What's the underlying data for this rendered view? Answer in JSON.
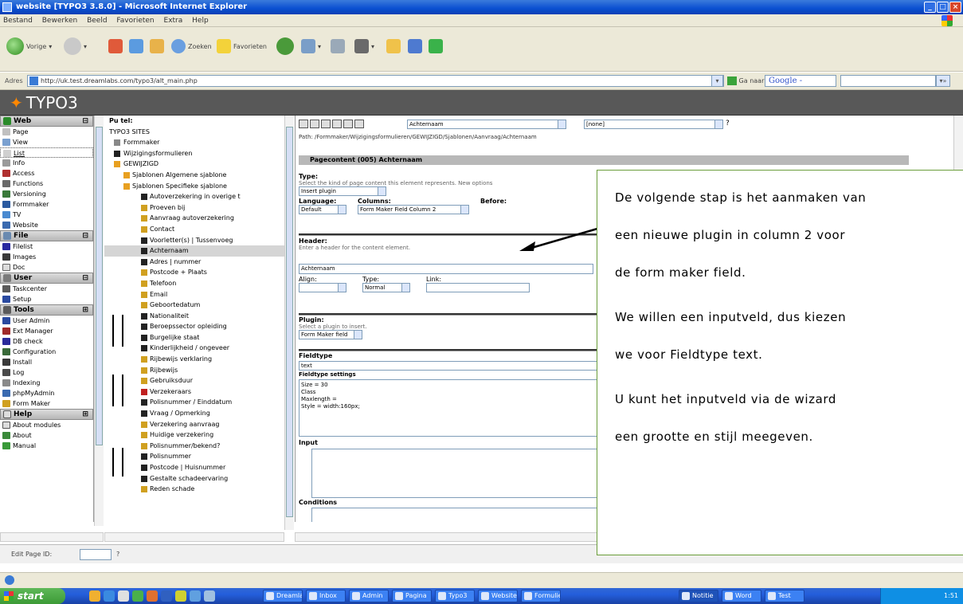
{
  "window": {
    "title": "website [TYPO3 3.8.0] - Microsoft Internet Explorer"
  },
  "menubar": [
    "Bestand",
    "Bewerken",
    "Beeld",
    "Favorieten",
    "Extra",
    "Help"
  ],
  "toolbar": {
    "back": "Vorige",
    "search": "Zoeken",
    "favorites": "Favorieten"
  },
  "address": {
    "label": "Adres",
    "url": "http://uk.test.dreamlabs.com/typo3/alt_main.php",
    "go": "Ga naar",
    "google": "Google -"
  },
  "typo3": {
    "logo": "TYPO3"
  },
  "modules": [
    {
      "group": "Web",
      "items": [
        "Page",
        "View",
        "List",
        "Info",
        "Access",
        "Functions",
        "Versioning",
        "Formmaker",
        "TV",
        "Website"
      ]
    },
    {
      "group": "File",
      "items": [
        "Filelist",
        "Images",
        "Doc"
      ]
    },
    {
      "group": "User",
      "items": [
        "Taskcenter",
        "Setup"
      ]
    },
    {
      "group": "Tools",
      "items": [
        "User Admin",
        "Ext Manager",
        "DB check",
        "Configuration",
        "Install",
        "Log",
        "Indexing",
        "phpMyAdmin",
        "Form Maker"
      ]
    },
    {
      "group": "Help",
      "items": [
        "About modules",
        "About",
        "Manual"
      ]
    }
  ],
  "pagetree": {
    "header": "Pu tel:",
    "root": "TYPO3 SITES",
    "items": [
      "Formmaker",
      "Wijzigingsformulieren",
      "GEWIJZIGD",
      "Sjablonen   Algemene sjablone",
      "Sjablonen   Specifieke sjablone",
      "Autoverzekering in overige t",
      "Proeven bij",
      "Aanvraag autoverzekering",
      "Contact",
      "Voorletter(s)  |  Tussenvoeg",
      "Achternaam",
      "Adres  |  nummer",
      "Postcode  +  Plaats",
      "Telefoon",
      "Email",
      "Geboortedatum",
      "Nationaliteit",
      "Beroepssector  opleiding",
      "Burgelijke staat",
      "Kinderlijkheid  /  ongeveer",
      "Rijbewijs verklaring",
      "Rijbewijs",
      "Gebruiksduur",
      "Verzekeraars",
      "Polisnummer / Einddatum",
      "Vraag  /  Opmerking",
      "Verzekering aanvraag",
      "Huidige verzekering",
      "Polisnummer/bekend?",
      "Polisnummer",
      "Postcode  |  Huisnummer",
      "Gestalte schadeervaring",
      "Reden schade"
    ]
  },
  "content": {
    "toolbar_select": "Achternaam",
    "lang_select": "[none]",
    "path": "Path: /Formmaker/Wijzigingsformulieren/GEWIJZIGD/Sjablonen/Aanvraag/Achternaam",
    "header": "Pagecontent (005) Achternaam",
    "type_label": "Type:",
    "type_help": "Select the kind of page content this element represents. New options",
    "type_value": "Insert plugin",
    "language_label": "Language:",
    "language_value": "Default",
    "columns_label": "Columns:",
    "columns_value": "Form Maker Field Column 2",
    "before_label": "Before:",
    "header_label": "Header:",
    "header_help": "Enter a header for the content element.",
    "header_value": "Achternaam",
    "align_label": "Align:",
    "type2_label": "Type:",
    "type2_value": "Normal",
    "link_label": "Link:",
    "plugin_label": "Plugin:",
    "plugin_help": "Select a plugin to insert.",
    "plugin_value": "Form Maker field",
    "fieldtype_label": "Fieldtype",
    "fieldtype_value": "text",
    "settings_label": "Fieldtype settings",
    "settings_lines": [
      "Size = 30",
      "Class",
      "Maxlength =",
      "Style = width:160px;"
    ],
    "input_label": "Input",
    "conditions_label": "Conditions"
  },
  "callout": {
    "lines": [
      "De volgende stap is het aanmaken van",
      "een nieuwe plugin in column 2 voor",
      "de form maker field.",
      "We willen een inputveld, dus kiezen",
      "we voor Fieldtype text.",
      "U kunt het inputveld via de wizard",
      "een grootte en stijl meegeven."
    ]
  },
  "editpage": {
    "label": "Edit Page ID:"
  },
  "taskbar": {
    "start": "start",
    "tasks": [
      "Dreamlabs",
      "Inbox",
      "Admin",
      "Pagina",
      "Typo3",
      "Website",
      "Formulier",
      "Notitie",
      "Word",
      "Test"
    ],
    "clock": "1:51"
  }
}
